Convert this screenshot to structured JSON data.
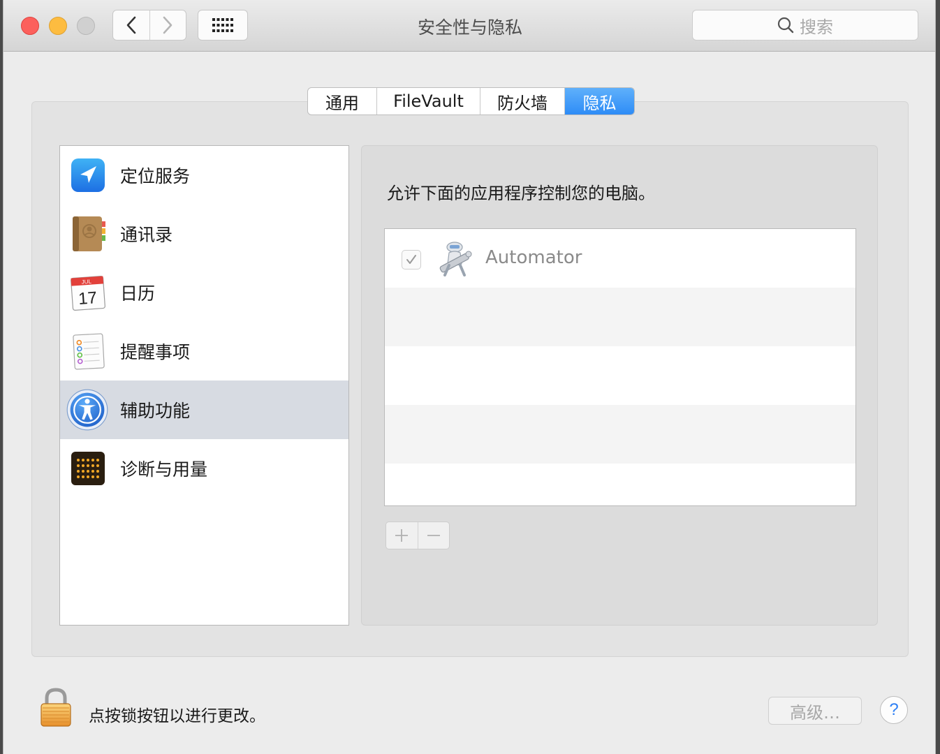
{
  "window": {
    "title": "安全性与隐私"
  },
  "search": {
    "placeholder": "搜索"
  },
  "tabs": [
    {
      "label": "通用",
      "active": false
    },
    {
      "label": "FileVault",
      "active": false
    },
    {
      "label": "防火墙",
      "active": false
    },
    {
      "label": "隐私",
      "active": true
    }
  ],
  "services": [
    {
      "label": "定位服务",
      "icon": "location-arrow-icon",
      "selected": false
    },
    {
      "label": "通讯录",
      "icon": "contacts-book-icon",
      "selected": false
    },
    {
      "label": "日历",
      "icon": "calendar-icon",
      "selected": false,
      "icon_month": "JUL",
      "icon_day": "17"
    },
    {
      "label": "提醒事项",
      "icon": "reminders-icon",
      "selected": false
    },
    {
      "label": "辅助功能",
      "icon": "accessibility-icon",
      "selected": true
    },
    {
      "label": "诊断与用量",
      "icon": "diagnostics-icon",
      "selected": false
    }
  ],
  "privacy": {
    "description": "允许下面的应用程序控制您的电脑。",
    "apps": [
      {
        "name": "Automator",
        "checked": true,
        "enabled": false,
        "icon": "automator-robot-icon"
      }
    ],
    "add_symbol": "+",
    "remove_symbol": "−"
  },
  "footer": {
    "lock_text": "点按锁按钮以进行更改。",
    "advanced_label": "高级…",
    "help_label": "?"
  },
  "colors": {
    "accent": "#2e8cf6",
    "selected_row": "#d7dbe2",
    "close": "#fc605c",
    "minimize": "#fdbc40"
  }
}
